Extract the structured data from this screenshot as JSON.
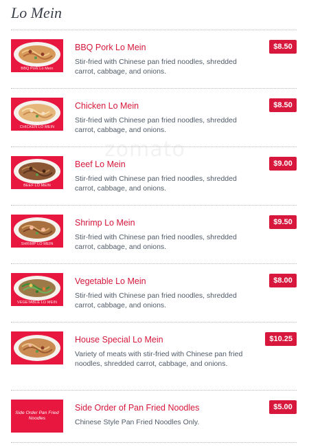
{
  "section_title": "Lo Mein",
  "watermark": "zomato",
  "items": [
    {
      "name": "BBQ Pork Lo Mein",
      "description": "Stir-fried with Chinese pan fried noodles, shredded carrot, cabbage, and onions.",
      "price": "$8.50",
      "image_caption": "BBQ Pork Lo Mein"
    },
    {
      "name": "Chicken Lo Mein",
      "description": "Stir-fried with Chinese pan fried noodles, shredded carrot, cabbage, and onions.",
      "price": "$8.50",
      "image_caption": "CHICKEN LO MEIN"
    },
    {
      "name": "Beef Lo Mein",
      "description": "Stir-fried with Chinese pan fried noodles, shredded carrot, cabbage, and onions.",
      "price": "$9.00",
      "image_caption": "BEEF LO MEIN"
    },
    {
      "name": "Shrimp Lo Mein",
      "description": "Stir-fried with Chinese pan fried noodles, shredded carrot, cabbage, and onions.",
      "price": "$9.50",
      "image_caption": "SHRIMP LO MEIN"
    },
    {
      "name": "Vegetable Lo Mein",
      "description": "Stir-fried with Chinese pan fried noodles, shredded carrot, cabbage, and onions.",
      "price": "$8.00",
      "image_caption": "VEGETABLE LO MEIN"
    },
    {
      "name": "House Special Lo Mein",
      "description": "Variety of meats with stir-fried with Chinese pan fried noodles, shredded carrot, cabbage, and onions.",
      "price": "$10.25",
      "image_caption": ""
    },
    {
      "name": "Side Order of Pan Fried Noodles",
      "description": "Chinese Style Pan Fried Noodles Only.",
      "price": "$5.00",
      "image_caption": "Side Order Pan Fried Noodles"
    }
  ],
  "colors": {
    "accent": "#d7173b",
    "thumb_bg": "#e8173f",
    "text": "#4f5a68"
  }
}
